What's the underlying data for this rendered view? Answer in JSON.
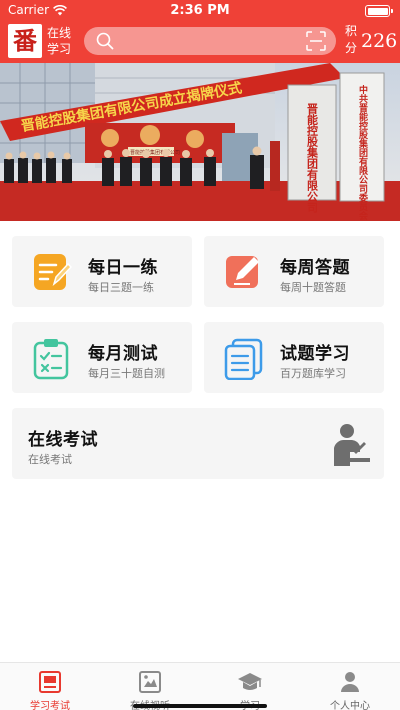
{
  "status_bar": {
    "carrier": "Carrier",
    "time": "2:36 PM"
  },
  "app_bar": {
    "logo_glyph": "番",
    "app_name": "在线学习",
    "search": {
      "placeholder": ""
    },
    "points_label": "积分",
    "points_value": "226"
  },
  "banner": {
    "red_banner_text": "晋能控股集团有限公司成立揭牌仪式",
    "plaque_left": "晋能控股集团有限公司",
    "plaque_right": "中共晋能控股集团有限公司委员会",
    "small_sign": "晋能控股集团有限公司",
    "dots": 2,
    "active_dot": 0
  },
  "cards": [
    {
      "id": "daily",
      "title": "每日一练",
      "subtitle": "每日三题一练",
      "icon": "pencil-note-icon",
      "color": "#f5a623"
    },
    {
      "id": "weekly",
      "title": "每周答题",
      "subtitle": "每周十题答题",
      "icon": "edit-square-icon",
      "color": "#f0705a"
    },
    {
      "id": "monthly",
      "title": "每月测试",
      "subtitle": "每月三十题自测",
      "icon": "clipboard-check-icon",
      "color": "#43c59e"
    },
    {
      "id": "bank",
      "title": "试题学习",
      "subtitle": "百万题库学习",
      "icon": "document-list-icon",
      "color": "#3d9be9"
    }
  ],
  "exam_card": {
    "title": "在线考试",
    "subtitle": "在线考试",
    "icon": "exam-person-icon"
  },
  "tabbar": [
    {
      "label": "学习考试",
      "icon": "study-exam-icon",
      "active": true
    },
    {
      "label": "在线视听",
      "icon": "video-icon",
      "active": false
    },
    {
      "label": "学习",
      "icon": "graduation-cap-icon",
      "active": false
    },
    {
      "label": "个人中心",
      "icon": "person-icon",
      "active": false
    }
  ],
  "colors": {
    "primary": "#ef4137",
    "card_bg": "#f5f5f5",
    "tab_active": "#e8392f"
  }
}
